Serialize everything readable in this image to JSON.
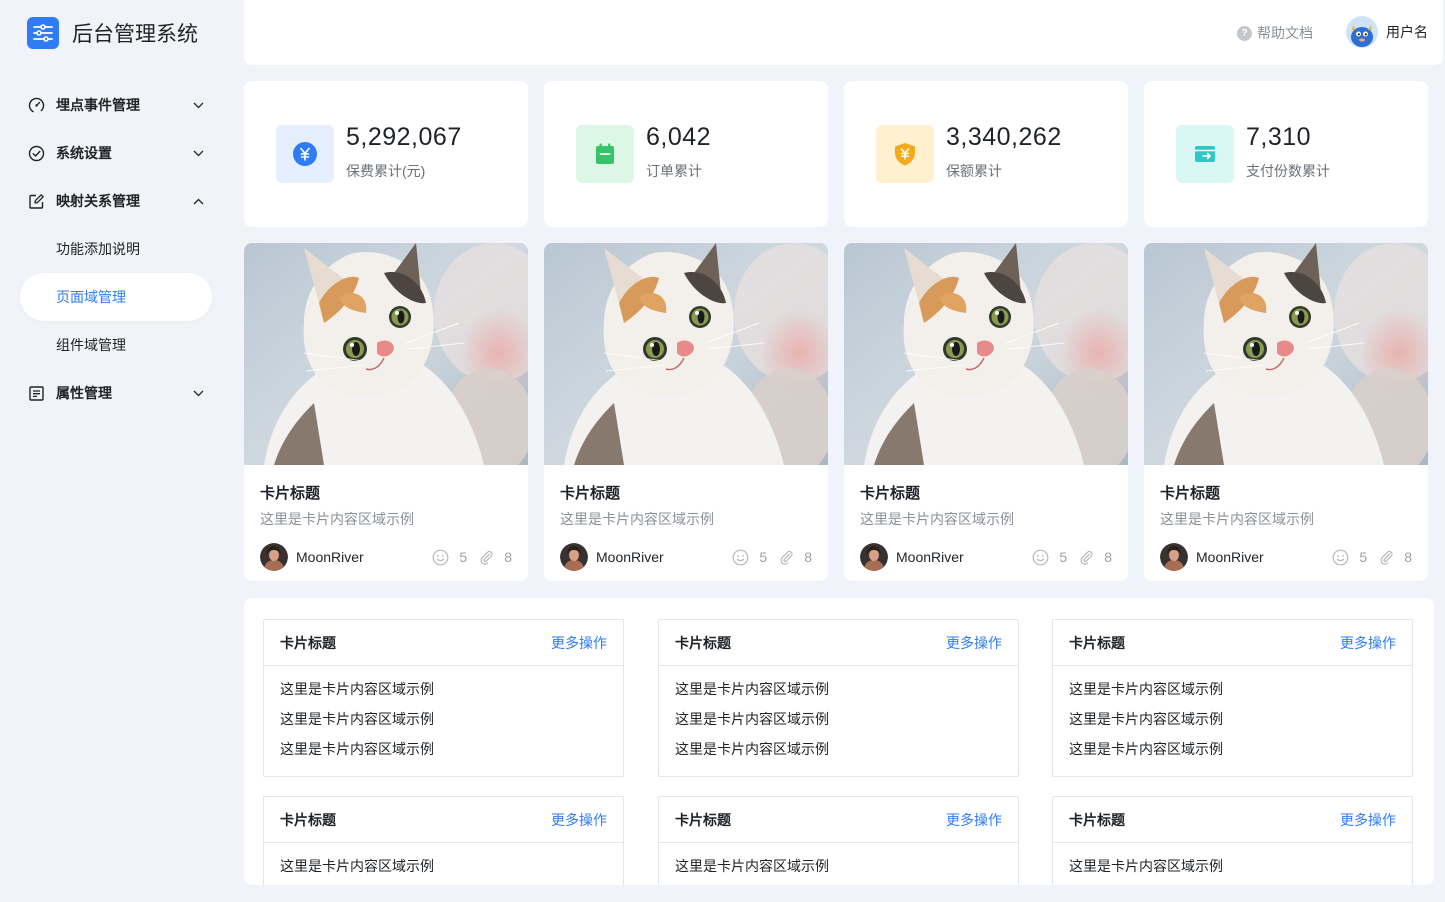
{
  "app": {
    "title": "后台管理系统"
  },
  "sidebar": {
    "items": [
      {
        "label": "埋点事件管理",
        "icon": "dashboard-icon",
        "expanded": false
      },
      {
        "label": "系统设置",
        "icon": "check-circle-icon",
        "expanded": false
      },
      {
        "label": "映射关系管理",
        "icon": "edit-icon",
        "expanded": true,
        "children": [
          {
            "label": "功能添加说明",
            "active": false
          },
          {
            "label": "页面域管理",
            "active": true
          },
          {
            "label": "组件域管理",
            "active": false
          }
        ]
      },
      {
        "label": "属性管理",
        "icon": "list-icon",
        "expanded": false
      }
    ]
  },
  "header": {
    "help": "帮助文档",
    "username": "用户名"
  },
  "stats": [
    {
      "value": "5,292,067",
      "label": "保费累计(元)",
      "icon": "yen-circle-icon",
      "color": "#2f7cf6",
      "bg": "#e5efff"
    },
    {
      "value": "6,042",
      "label": "订单累计",
      "icon": "calendar-icon",
      "color": "#36c46a",
      "bg": "#ddf7e6"
    },
    {
      "value": "3,340,262",
      "label": "保额累计",
      "icon": "yen-shield-icon",
      "color": "#f5a91e",
      "bg": "#fff1cf"
    },
    {
      "value": "7,310",
      "label": "支付份数累计",
      "icon": "payment-card-icon",
      "color": "#2fc8c4",
      "bg": "#d9f7f5"
    }
  ],
  "image_cards": [
    {
      "title": "卡片标题",
      "desc": "这里是卡片内容区域示例",
      "author": "MoonRiver",
      "likes": "5",
      "attachments": "8"
    },
    {
      "title": "卡片标题",
      "desc": "这里是卡片内容区域示例",
      "author": "MoonRiver",
      "likes": "5",
      "attachments": "8"
    },
    {
      "title": "卡片标题",
      "desc": "这里是卡片内容区域示例",
      "author": "MoonRiver",
      "likes": "5",
      "attachments": "8"
    },
    {
      "title": "卡片标题",
      "desc": "这里是卡片内容区域示例",
      "author": "MoonRiver",
      "likes": "5",
      "attachments": "8"
    }
  ],
  "list_cards": [
    {
      "title": "卡片标题",
      "more": "更多操作",
      "lines": [
        "这里是卡片内容区域示例",
        "这里是卡片内容区域示例",
        "这里是卡片内容区域示例"
      ]
    },
    {
      "title": "卡片标题",
      "more": "更多操作",
      "lines": [
        "这里是卡片内容区域示例",
        "这里是卡片内容区域示例",
        "这里是卡片内容区域示例"
      ]
    },
    {
      "title": "卡片标题",
      "more": "更多操作",
      "lines": [
        "这里是卡片内容区域示例",
        "这里是卡片内容区域示例",
        "这里是卡片内容区域示例"
      ]
    },
    {
      "title": "卡片标题",
      "more": "更多操作",
      "lines": [
        "这里是卡片内容区域示例"
      ]
    },
    {
      "title": "卡片标题",
      "more": "更多操作",
      "lines": [
        "这里是卡片内容区域示例"
      ]
    },
    {
      "title": "卡片标题",
      "more": "更多操作",
      "lines": [
        "这里是卡片内容区域示例"
      ]
    }
  ]
}
